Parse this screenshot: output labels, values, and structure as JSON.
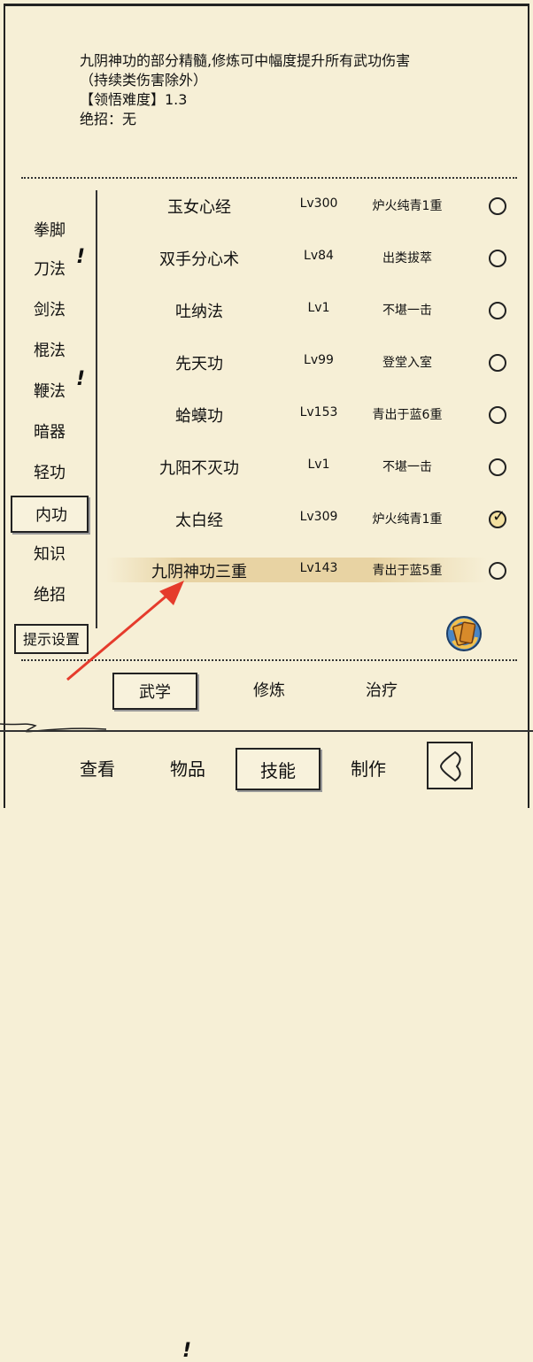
{
  "description": {
    "line1": "九阴神功的部分精髓,修炼可中幅度提升所有武功伤害",
    "line2": "（持续类伤害除外）",
    "line3": "【领悟难度】1.3",
    "line4": "绝招：无"
  },
  "categories": [
    "拳脚",
    "刀法",
    "剑法",
    "棍法",
    "鞭法",
    "暗器",
    "轻功",
    "内功",
    "知识",
    "绝招"
  ],
  "selected_category": "内功",
  "hint_settings_label": "提示设置",
  "skills": [
    {
      "name": "玉女心经",
      "level": "Lv300",
      "rank": "炉火纯青1重",
      "equipped": false
    },
    {
      "name": "双手分心术",
      "level": "Lv84",
      "rank": "出类拔萃",
      "equipped": false
    },
    {
      "name": "吐纳法",
      "level": "Lv1",
      "rank": "不堪一击",
      "equipped": false
    },
    {
      "name": "先天功",
      "level": "Lv99",
      "rank": "登堂入室",
      "equipped": false
    },
    {
      "name": "蛤蟆功",
      "level": "Lv153",
      "rank": "青出于蓝6重",
      "equipped": false
    },
    {
      "name": "九阳不灭功",
      "level": "Lv1",
      "rank": "不堪一击",
      "equipped": false
    },
    {
      "name": "太白经",
      "level": "Lv309",
      "rank": "炉火纯青1重",
      "equipped": true
    },
    {
      "name": "九阴神功三重",
      "level": "Lv143",
      "rank": "青出于蓝5重",
      "equipped": false
    }
  ],
  "sub_tabs": [
    "武学",
    "修炼",
    "治疗"
  ],
  "bottom_tabs": [
    "查看",
    "物品",
    "技能",
    "制作"
  ],
  "colors": {
    "background": "#f6efd6",
    "highlight": "#e8d3a3",
    "arrow": "#e53b2c"
  }
}
